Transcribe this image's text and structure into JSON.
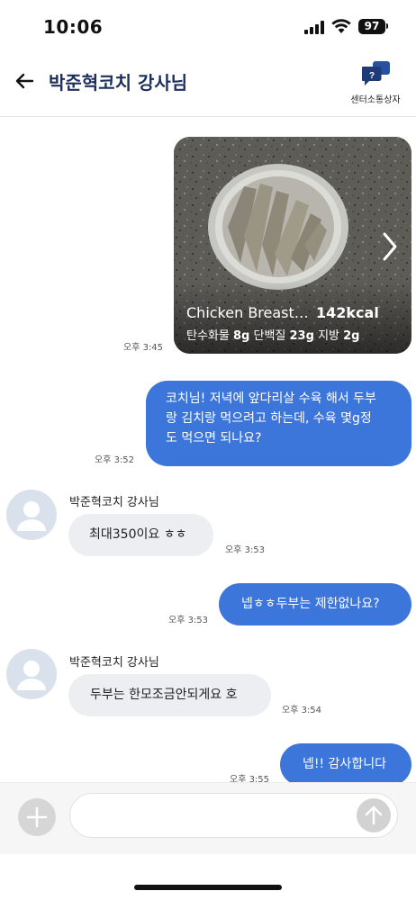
{
  "status_bar": {
    "time": "10:06",
    "battery": "97"
  },
  "header": {
    "title": "박준혁코치 강사님",
    "center_label": "센터소통상자",
    "center_icon_glyph": "?"
  },
  "messages": {
    "food_card": {
      "name": "Chicken Breast…",
      "kcal": "142kcal",
      "carb_label": "탄수화물",
      "carb_value": "8g",
      "protein_label": "단백질",
      "protein_value": "23g",
      "fat_label": "지방",
      "fat_value": "2g",
      "time": "오후 3:45"
    },
    "m1": {
      "line1": "코치님! 저녁에 앞다리살 수육 해서 두부",
      "line2": "랑 김치랑 먹으려고 하는데, 수육 몇g정",
      "line3": "도 먹으면 되나요?",
      "time": "오후 3:52"
    },
    "m2": {
      "sender": "박준혁코치 강사님",
      "text": "최대350이요 ㅎㅎ",
      "time": "오후 3:53"
    },
    "m3": {
      "text": "넵ㅎㅎ두부는 제한없나요?",
      "time": "오후 3:53"
    },
    "m4": {
      "sender": "박준혁코치 강사님",
      "text": "두부는 한모조금안되게요 호",
      "time": "오후 3:54"
    },
    "m5": {
      "text": "넵!! 감사합니다",
      "time": "오후 3:55"
    }
  },
  "input": {
    "placeholder": ""
  },
  "colors": {
    "accent": "#3d76db",
    "title": "#1d2f5c",
    "incoming_bubble": "#eceef2"
  }
}
